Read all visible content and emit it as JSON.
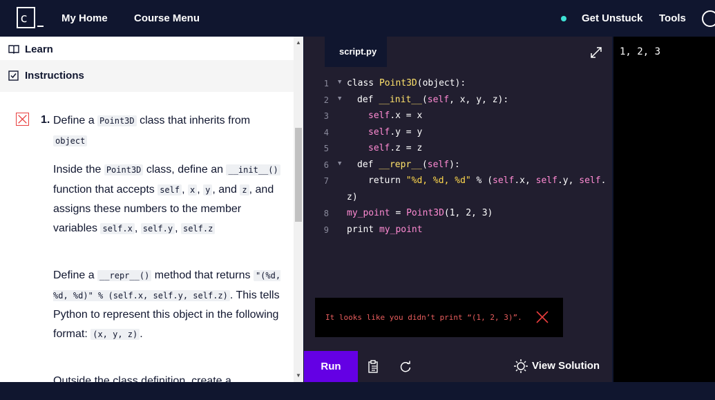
{
  "header": {
    "logo_letter": "c",
    "nav": [
      "My Home",
      "Course Menu"
    ],
    "get_unstuck": "Get Unstuck",
    "tools": "Tools",
    "status_color": "#3ee1d4"
  },
  "left": {
    "tabs": {
      "learn": "Learn",
      "instructions": "Instructions"
    },
    "task": {
      "number": "1.",
      "status": "failed",
      "p1": {
        "a": "Define a ",
        "code1": "Point3D",
        "b": " class that inherits from ",
        "code2": "object"
      },
      "p2": {
        "a": "Inside the ",
        "code1": "Point3D",
        "b": " class, define an ",
        "code2": "__init__()",
        "c": " function that accepts ",
        "code3": "self",
        "d": ", ",
        "code4": "x",
        "e": ", ",
        "code5": "y",
        "f": ", and ",
        "code6": "z",
        "g": ", and assigns these numbers to the member variables ",
        "code7": "self.x",
        "h": ", ",
        "code8": "self.y",
        "i": ", ",
        "code9": "self.z"
      },
      "p3": {
        "a": "Define a ",
        "code1": "__repr__()",
        "b": " method that returns ",
        "code2": "\"(%d, %d, %d)\" % (self.x, self.y, self.z)",
        "c": ". This tells Python to represent this object in the following format: ",
        "code3": "(x, y, z)",
        "d": "."
      },
      "p4_partial": "Outside the class definition, create a"
    }
  },
  "editor": {
    "filename": "script.py",
    "line_numbers": [
      "1",
      "2",
      "3",
      "4",
      "5",
      "6",
      "7",
      "",
      "8",
      "9"
    ],
    "code": {
      "l1": {
        "kw": "class ",
        "name": "Point3D",
        "rest": "(object):"
      },
      "l2": {
        "kw": "def ",
        "name": "__init__",
        "p1": "(",
        "self": "self",
        "rest": ", x, y, z):"
      },
      "l3": {
        "self": "self",
        "rest": ".x = x"
      },
      "l4": {
        "self": "self",
        "rest": ".y = y"
      },
      "l5": {
        "self": "self",
        "rest": ".z = z"
      },
      "l6": {
        "kw": "def ",
        "name": "__repr__",
        "p1": "(",
        "self": "self",
        "rest": "):"
      },
      "l7": {
        "kw": "return ",
        "str": "\"%d, %d, %d\"",
        "op": " % (",
        "s1": "self",
        "r1": ".x, ",
        "s2": "self",
        "r2": ".y, ",
        "s3": "self",
        "r3": "."
      },
      "l7b": "z)",
      "l8": {
        "var": "my_point",
        "rest": " = ",
        "name": "Point3D",
        "args": "(1, 2, 3)"
      },
      "l9": {
        "kw": "print ",
        "var": "my_point"
      }
    },
    "error_message": "It looks like you didn’t print “(1, 2, 3)”.",
    "run_label": "Run",
    "view_solution_label": "View Solution"
  },
  "output": {
    "text": "1, 2, 3"
  }
}
